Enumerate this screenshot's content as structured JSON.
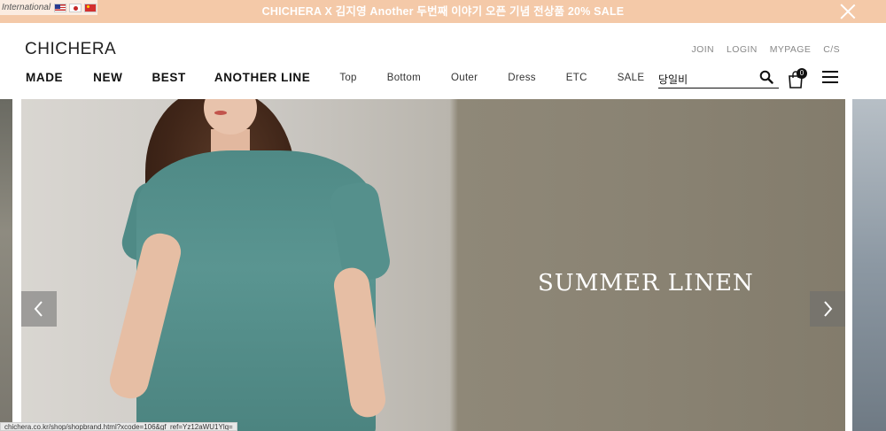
{
  "promo": {
    "text": "CHICHERA X 김지영 Another 두번째 이야기 오픈 기념 전상품 20% SALE",
    "international_label": "International",
    "flags": [
      "us-flag",
      "japan-flag",
      "china-flag"
    ],
    "background": "#f4c9a8"
  },
  "header": {
    "logo": "CHICHERA",
    "util_nav": [
      "JOIN",
      "LOGIN",
      "MYPAGE",
      "C/S"
    ],
    "main_nav_bold": [
      "MADE",
      "NEW",
      "BEST",
      "ANOTHER LINE"
    ],
    "main_nav_light": [
      "Top",
      "Bottom",
      "Outer",
      "Dress",
      "ETC",
      "SALE"
    ],
    "search": {
      "hint": "당일비",
      "placeholder": ""
    },
    "cart_count": "0"
  },
  "hero": {
    "title": "SUMMER LINEN",
    "prev_icon": "chevron-left-icon",
    "next_icon": "chevron-right-icon"
  },
  "status_bar": {
    "url": "chichera.co.kr/shop/shopbrand.html?xcode=106&gf_ref=Yz12aWU1Ylq="
  }
}
